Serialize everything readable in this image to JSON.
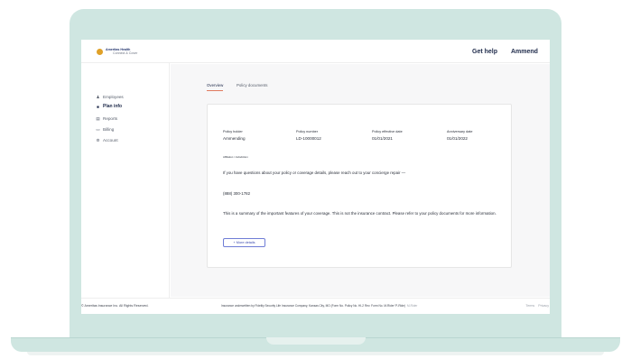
{
  "logo": {
    "line1": "Ameritas Health",
    "line2": "Connect & Cover"
  },
  "topbar": {
    "help_label": "Get help",
    "user_label": "Ammend"
  },
  "sidebar": {
    "items": [
      {
        "label": "Employees",
        "icon": "people-icon"
      },
      {
        "label": "Plan info",
        "icon": "document-icon"
      },
      {
        "label": "Reports",
        "icon": "report-icon"
      },
      {
        "label": "Billing",
        "icon": "card-icon"
      },
      {
        "label": "Account",
        "icon": "gear-icon"
      }
    ],
    "active_index": 1
  },
  "tabs": [
    {
      "label": "Overview",
      "active": true
    },
    {
      "label": "Policy documents",
      "active": false
    }
  ],
  "policy": {
    "fields": [
      {
        "label": "Policy holder",
        "value": "Ammending"
      },
      {
        "label": "Policy number",
        "value": "LD-10000012"
      },
      {
        "label": "Policy effective date",
        "value": "01/01/2021"
      },
      {
        "label": "Anniversary date",
        "value": "01/01/2022"
      }
    ],
    "affiliation_label": "Affiliation / Jurisdiction",
    "intro_text": "If you have questions about your policy or coverage details, please reach out to your concierge repair —",
    "phone": "(888) 300-1782",
    "summary_text": "This is a summary of the important features of your coverage. This is not the insurance contract. Please refer to your policy documents for more information.",
    "more_details_label": "+ More details"
  },
  "footer": {
    "copyright": "© Ameritas Insurance Inc. All Rights Reserved.",
    "underwriter_text": "Insurance underwritten by Fidelity Security Life Insurance Company, Kansas City, MO (Form No. Policy No. HI-2 Rev. Form No. M-Rider 'P-Ride)",
    "underwriter_muted": "M-Rider",
    "terms_label": "Terms",
    "privacy_label": "Privacy"
  },
  "colors": {
    "laptop_frame": "#cfe6e1",
    "tab_underline": "#e07a5f",
    "button_border": "#6f7dd6",
    "main_background": "#f7f7f8",
    "brand_navy": "#25366f",
    "brand_gold": "#e0a128"
  }
}
